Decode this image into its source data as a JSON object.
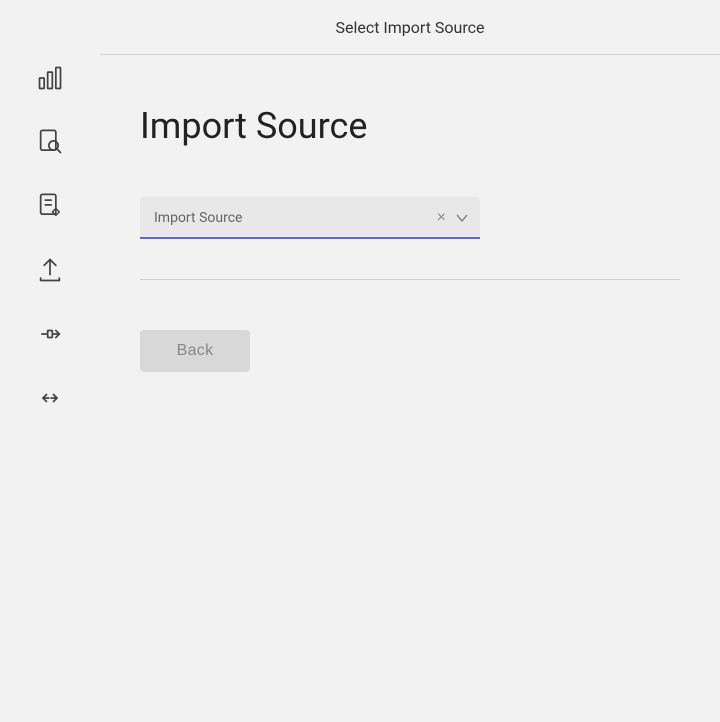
{
  "header": {
    "title": "Select Import Source"
  },
  "page": {
    "title": "Import Source",
    "select_placeholder": "Import Source",
    "back_button_label": "Back"
  },
  "sidebar": {
    "icons": [
      {
        "name": "bar-chart-icon",
        "label": "Dashboard"
      },
      {
        "name": "search-document-icon",
        "label": "Search"
      },
      {
        "name": "edit-document-icon",
        "label": "Edit"
      },
      {
        "name": "upload-icon",
        "label": "Upload"
      },
      {
        "name": "flow-icon",
        "label": "Flow"
      },
      {
        "name": "collapse-icon",
        "label": "Collapse"
      }
    ]
  }
}
